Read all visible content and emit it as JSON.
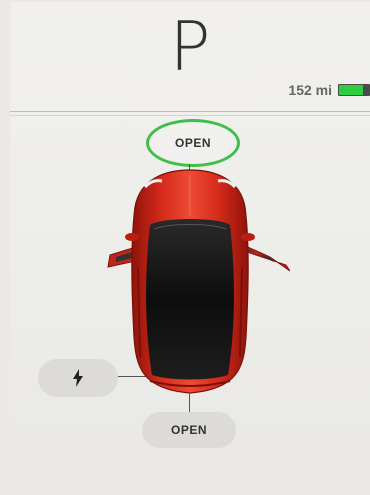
{
  "gear": {
    "value": "P"
  },
  "range": {
    "text": "152 mi",
    "battery_level": 0.75,
    "battery_color": "#2ecc40"
  },
  "frunk": {
    "label": "OPEN"
  },
  "trunk": {
    "label": "OPEN"
  },
  "charge_port": {
    "icon": "lightning-bolt-icon"
  },
  "colors": {
    "car_body": "#d42a1a",
    "glass": "#111111",
    "highlight_ring": "#3fbf49"
  }
}
